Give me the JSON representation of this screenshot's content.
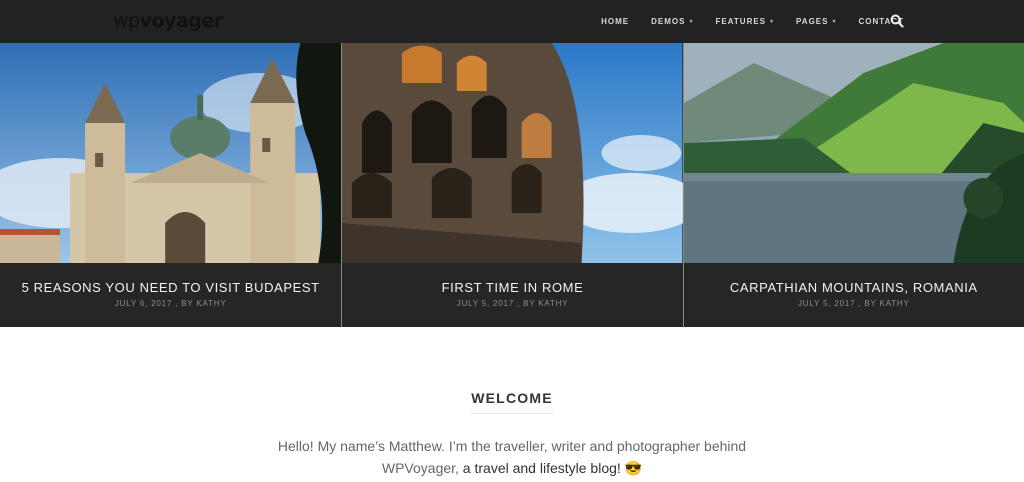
{
  "header": {
    "logo": {
      "part1": "wp",
      "part2": "voyager"
    },
    "nav": [
      {
        "label": "HOME",
        "caret": false
      },
      {
        "label": "DEMOS",
        "caret": true
      },
      {
        "label": "FEATURES",
        "caret": true
      },
      {
        "label": "PAGES",
        "caret": true
      },
      {
        "label": "CONTACT",
        "caret": false
      }
    ],
    "search_icon": "search-icon"
  },
  "slides": [
    {
      "title": "5 REASONS YOU NEED TO VISIT BUDAPEST",
      "meta": "JULY 6, 2017 , BY KATHY"
    },
    {
      "title": "FIRST TIME IN ROME",
      "meta": "JULY 5, 2017 , BY KATHY"
    },
    {
      "title": "CARPATHIAN MOUNTAINS, ROMANIA",
      "meta": "JULY 5, 2017 , BY KATHY"
    }
  ],
  "welcome": {
    "title": "WELCOME",
    "line1": "Hello! My name’s Matthew. I’m the traveller, writer and photographer behind",
    "line2a": "WPVoyager,",
    "line2b": " a travel and lifestyle blog! ",
    "emoji": "😎"
  },
  "colors": {
    "header_bg": "#222222",
    "caption_bg": "#262626",
    "nav_text": "#d9d9d9"
  }
}
